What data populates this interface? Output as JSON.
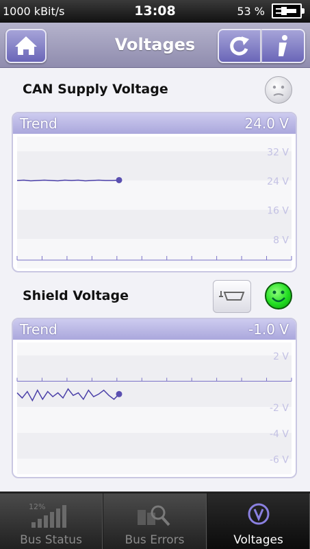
{
  "status": {
    "bitrate": "1000 kBit/s",
    "time": "13:08",
    "battery": "53 %"
  },
  "header": {
    "title": "Voltages",
    "icons": [
      "home-icon",
      "refresh-icon",
      "info-icon"
    ]
  },
  "can_supply": {
    "label": "CAN Supply Voltage",
    "status_icon": "neutral-face-icon",
    "trend_label": "Trend",
    "current_value": "24.0 V",
    "y_ticks": [
      "32 V",
      "24 V",
      "16 V",
      "8 V"
    ],
    "y_tick_values": [
      32,
      24,
      16,
      8
    ],
    "y_range": [
      0,
      36
    ],
    "series": [
      24.0,
      24.1,
      23.9,
      24.0,
      24.1,
      24.0,
      23.9,
      24.1,
      24.0,
      24.1,
      23.9,
      24.0,
      24.1,
      24.0,
      24.0,
      24.1
    ]
  },
  "shield": {
    "label": "Shield Voltage",
    "connector_icon": "ground-connector-icon",
    "status_icon": "happy-face-icon",
    "trend_label": "Trend",
    "current_value": "-1.0 V",
    "y_ticks": [
      "2 V",
      "-2 V",
      "-4 V",
      "-6 V"
    ],
    "y_tick_values": [
      2,
      -2,
      -4,
      -6
    ],
    "zero_line": 0,
    "y_range": [
      -7.2,
      3
    ],
    "series": [
      -0.9,
      -1.3,
      -0.8,
      -1.5,
      -0.7,
      -1.4,
      -0.8,
      -1.2,
      -0.9,
      -1.3,
      -0.6,
      -1.1,
      -0.9,
      -1.4,
      -0.7,
      -1.2,
      -1.0,
      -0.7,
      -1.1,
      -1.4,
      -1.0
    ]
  },
  "tabs": [
    {
      "label": "Bus Status",
      "icon": "signal-bars-icon",
      "badge": "12%",
      "active": false
    },
    {
      "label": "Bus Errors",
      "icon": "magnifier-icon",
      "active": false
    },
    {
      "label": "Voltages",
      "icon": "voltage-icon",
      "active": true
    }
  ],
  "colors": {
    "accent": "#5a4fb0",
    "header": "#9f9cc0",
    "trend_header": "#b9b6e4",
    "ok": "#22dd22"
  }
}
